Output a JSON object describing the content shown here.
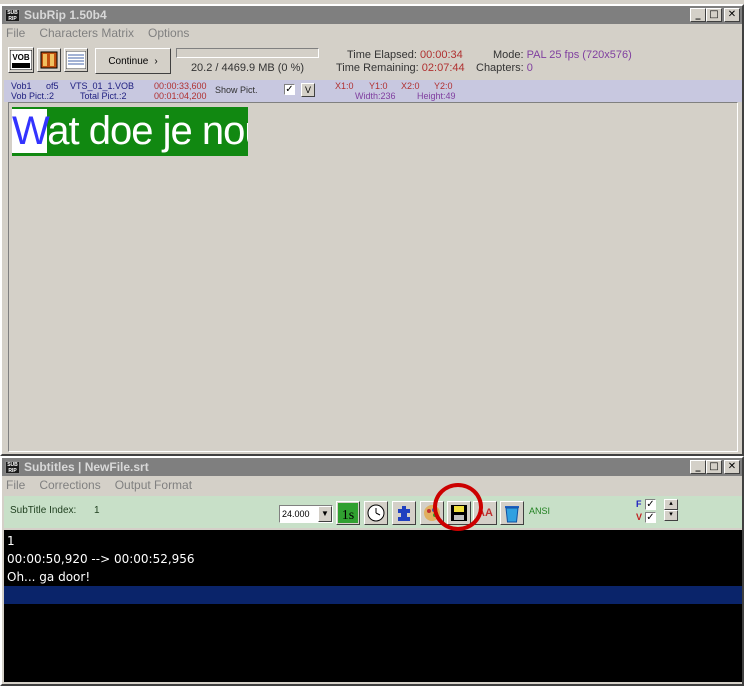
{
  "main_window": {
    "title": "SubRip 1.50b4",
    "menu": [
      "File",
      "Characters Matrix",
      "Options"
    ],
    "toolbar": {
      "vob_icon": "vob-icon",
      "film_icon": "film-icon",
      "matrix_icon": "matrix-icon",
      "continue_label": "Continue",
      "progress_percent": 0,
      "size_text": "20.2 / 4469.9 MB (0 %)"
    },
    "stats": {
      "elapsed_label": "Time Elapsed:",
      "elapsed_value": "00:00:34",
      "remaining_label": "Time Remaining:",
      "remaining_value": "02:07:44",
      "mode_label": "Mode:",
      "mode_value": "PAL 25 fps (720x576)",
      "chapters_label": "Chapters:",
      "chapters_value": "0"
    },
    "info": {
      "vob": "Vob1",
      "of": "of5",
      "file": "VTS_01_1.VOB",
      "time1": "00:00:33,600",
      "time2": "00:01:04,200",
      "show_pict": "Show Pict.",
      "show_pict_checked": true,
      "v_label": "V",
      "vob_pict": "Vob Pict.:2",
      "total_pict": "Total Pict.:2",
      "x1": "X1:0",
      "y1": "Y1:0",
      "x2": "X2:0",
      "y2": "Y2:0",
      "width": "Width:236",
      "height": "Height:49"
    },
    "subtitle_image_text_first": "W",
    "subtitle_image_text_rest": "at doe je nou...?"
  },
  "subtitles_window": {
    "title": "Subtitles | NewFile.srt",
    "menu": [
      "File",
      "Corrections",
      "Output Format"
    ],
    "toolbar": {
      "index_label": "SubTitle Index:",
      "index_value": "1",
      "fps_value": "24.000",
      "ansi_label": "ANSI",
      "f_label": "F",
      "v_label": "V",
      "f_checked": true,
      "v_checked": true
    },
    "lines": [
      "1",
      "00:00:50,920 --> 00:00:52,956",
      "Oh... ga door!",
      ""
    ]
  },
  "colors": {
    "title_inactive": "#7f7f7f",
    "subtitle_bg": "#118811",
    "editor_bg": "#000000",
    "selection": "#0a246a",
    "highlight_circle": "#cc0000"
  }
}
